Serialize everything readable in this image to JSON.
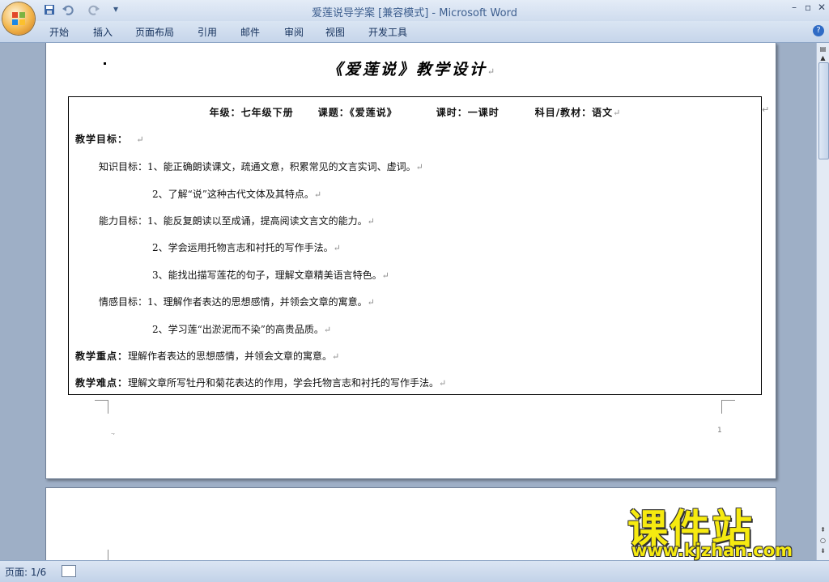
{
  "window": {
    "title": "爱莲说导学案 [兼容模式] - Microsoft Word",
    "controls": {
      "minimize": "–",
      "restore": "▫",
      "close": "✕"
    }
  },
  "quick_access": {
    "save_icon": "save-icon",
    "undo_icon": "undo-icon",
    "redo_icon": "redo-icon",
    "customize_label": "▾"
  },
  "ribbon": {
    "tabs": [
      "开始",
      "插入",
      "页面布局",
      "引用",
      "邮件",
      "审阅",
      "视图",
      "开发工具"
    ],
    "help_label": "?"
  },
  "document": {
    "title": "《爱莲说》教学设计",
    "header": {
      "grade": "年级：七年级下册",
      "lesson": "课题：《爱莲说》",
      "period": "课时：一课时",
      "subject": "科目/教材：语文"
    },
    "objectives_heading": "教学目标：",
    "knowledge_label": "知识目标：",
    "knowledge_1": "1、能正确朗读课文，疏通文意，积累常见的文言实词、虚词。",
    "knowledge_2": "2、了解“说”这种古代文体及其特点。",
    "ability_label": "能力目标：",
    "ability_1": "1、能反复朗读以至成诵，提高阅读文言文的能力。",
    "ability_2": "2、学会运用托物言志和衬托的写作手法。",
    "ability_3": "3、能找出描写莲花的句子，理解文章精美语言特色。",
    "emotion_label": "情感目标：",
    "emotion_1": "1、理解作者表达的思想感情，并领会文章的寓意。",
    "emotion_2": "2、学习莲“出淤泥而不染”的高贵品质。",
    "key_point_label": "教学重点：",
    "key_point": "理解作者表达的思想感情，并领会文章的寓意。",
    "difficulty_label": "教学难点：",
    "difficulty": "理解文章所写牡丹和菊花表达的作用，学会托物言志和衬托的写作手法。",
    "paragraph_mark": "↵",
    "page_number": "1"
  },
  "status": {
    "page": "页面: 1/6"
  },
  "watermark": {
    "name": "课件站",
    "url": "www.kjzhan.com"
  }
}
